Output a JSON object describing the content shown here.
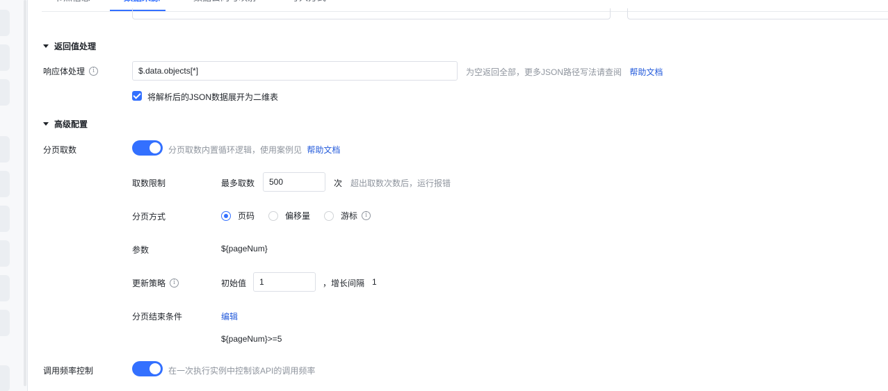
{
  "tabs": [
    {
      "label": "节点信息"
    },
    {
      "label": "数据来源"
    },
    {
      "label": "数据去向与映射"
    },
    {
      "label": "写入方式"
    }
  ],
  "response_section": {
    "title": "返回值处理",
    "body_label": "响应体处理",
    "body_value": "$.data.objects[*]",
    "body_hint": "为空返回全部，更多JSON路径写法请查阅",
    "help_link": "帮助文档",
    "flatten_label": "将解析后的JSON数据展开为二维表"
  },
  "advanced_section": {
    "title": "高级配置",
    "pagination_label": "分页取数",
    "pagination_hint": "分页取数内置循环逻辑，使用案例见",
    "help_link": "帮助文档",
    "fetch_limit_label": "取数限制",
    "max_fetch_label": "最多取数",
    "max_fetch_value": "500",
    "max_fetch_unit": "次",
    "max_fetch_hint": "超出取数次数后，运行报错",
    "pagination_mode_label": "分页方式",
    "pagination_modes": [
      {
        "label": "页码",
        "checked": true
      },
      {
        "label": "偏移量",
        "checked": false
      },
      {
        "label": "游标",
        "checked": false
      }
    ],
    "param_label": "参数",
    "param_value": "${pageNum}",
    "update_strategy_label": "更新策略",
    "initial_label": "初始值",
    "initial_value": "1",
    "step_label": "，增长间隔",
    "step_value": "1",
    "end_condition_label": "分页结束条件",
    "edit_link": "编辑",
    "end_condition_value": "${pageNum}>=5",
    "rate_limit_label": "调用频率控制",
    "rate_limit_hint": "在一次执行实例中控制该API的调用频率"
  },
  "colors": {
    "accent": "#3370ff",
    "link": "#245bdb",
    "hint": "#8f959e"
  }
}
